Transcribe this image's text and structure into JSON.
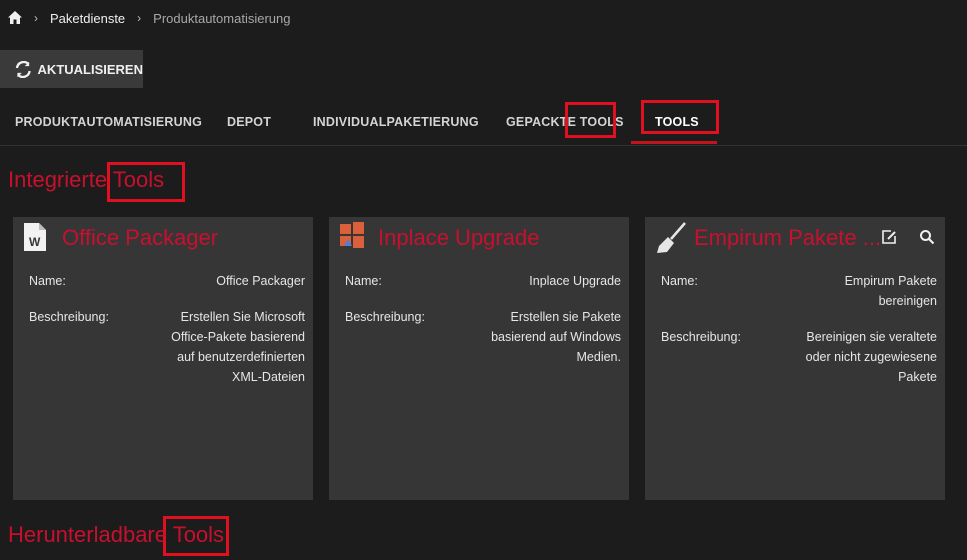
{
  "breadcrumb": {
    "items": [
      "Paketdienste",
      "Produktautomatisierung"
    ]
  },
  "toolbar": {
    "refresh_label": "AKTUALISIEREN"
  },
  "tabs": [
    {
      "label": "PRODUKTAUTOMATISIERUNG"
    },
    {
      "label": "DEPOT"
    },
    {
      "label": "INDIVIDUALPAKETIERUNG"
    },
    {
      "label": "GEPACKTE TOOLS"
    },
    {
      "label": "TOOLS",
      "active": true
    }
  ],
  "sections": {
    "integrated": "Integrierte Tools",
    "downloadable": "Herunterladbare Tools"
  },
  "field_labels": {
    "name": "Name:",
    "description": "Beschreibung:"
  },
  "cards": [
    {
      "title": "Office Packager",
      "icon": "word-file-icon",
      "name": "Office Packager",
      "description": "Erstellen Sie Microsoft Office-Pakete basierend auf benutzerdefinierten XML-Dateien"
    },
    {
      "title": "Inplace Upgrade",
      "icon": "windows-upgrade-icon",
      "name": "Inplace Upgrade",
      "description": "Erstellen sie Pakete basierend auf Windows Medien."
    },
    {
      "title": "Empirum Pakete ...",
      "icon": "broom-icon",
      "name": "Empirum Pakete bereinigen",
      "description": "Bereinigen sie veraltete oder nicht zugewiesene Pakete",
      "actions": [
        "edit-icon",
        "search-icon"
      ]
    }
  ],
  "colors": {
    "accent": "#c8102e",
    "background": "#1c1c1c",
    "card": "#363636",
    "highlight": "#e01020"
  }
}
